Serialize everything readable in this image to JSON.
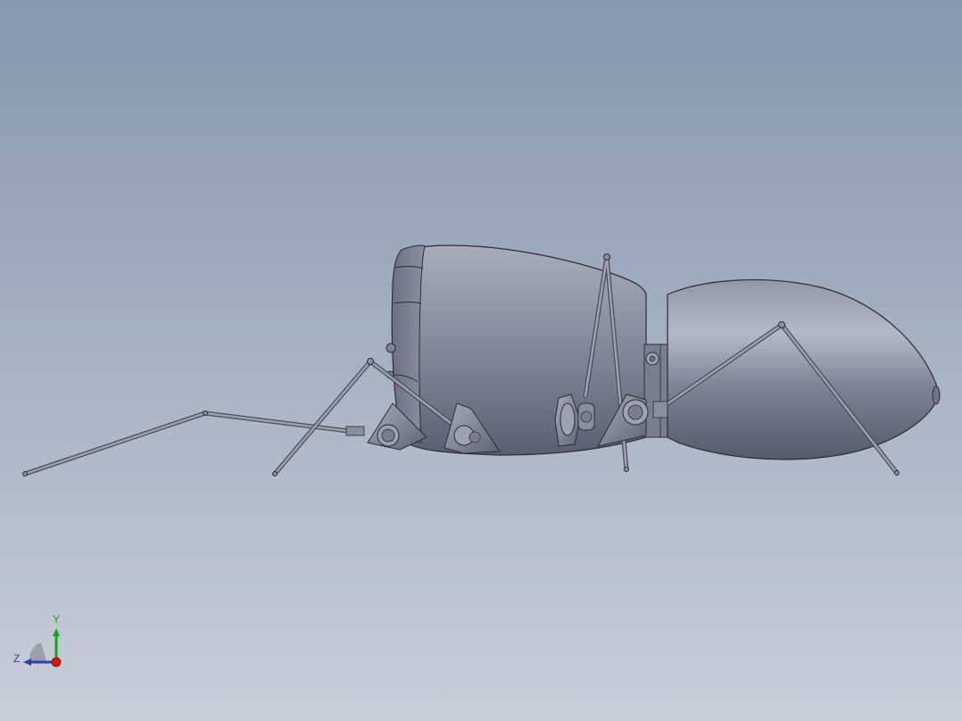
{
  "viewport": {
    "background_top": "#8797ac",
    "background_bottom": "#c9ced9"
  },
  "model": {
    "body_color": "#7f8496",
    "body_highlight": "#b6bac8",
    "body_shadow": "#555a6a",
    "edge_color": "#2a2d36",
    "leg_color": "#8a8fa0"
  },
  "triad": {
    "y_label": "Y",
    "z_label": "Z",
    "y_color": "#1aa01a",
    "z_color": "#2a3fb0",
    "x_color": "#d01818",
    "icon": "view-orientation-triad-icon"
  }
}
